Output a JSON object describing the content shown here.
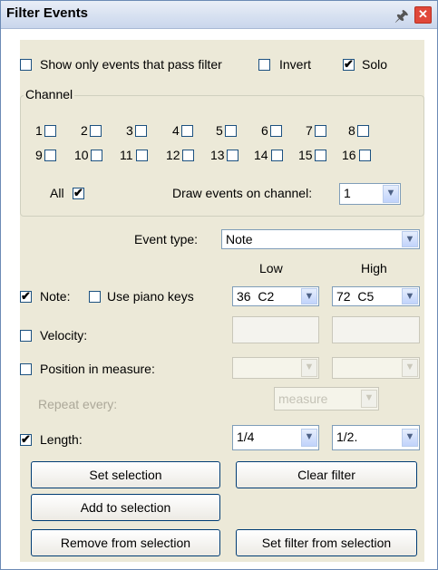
{
  "window": {
    "title": "Filter Events"
  },
  "top": {
    "show_only": {
      "label": "Show only events that pass filter",
      "checked": false
    },
    "invert": {
      "label": "Invert",
      "checked": false
    },
    "solo": {
      "label": "Solo",
      "checked": true
    }
  },
  "channel": {
    "title": "Channel",
    "row1": [
      "1",
      "2",
      "3",
      "4",
      "5",
      "6",
      "7",
      "8"
    ],
    "row2": [
      "9",
      "10",
      "11",
      "12",
      "13",
      "14",
      "15",
      "16"
    ],
    "all_label": "All",
    "all_checked": true,
    "draw_label": "Draw events on channel:",
    "draw_value": "1"
  },
  "event_type": {
    "label": "Event type:",
    "value": "Note"
  },
  "headers": {
    "low": "Low",
    "high": "High"
  },
  "note": {
    "label": "Note:",
    "checked": true,
    "piano_label": "Use piano keys",
    "piano_checked": false,
    "low": "36  C2",
    "high": "72  C5"
  },
  "velocity": {
    "label": "Velocity:",
    "checked": false
  },
  "position": {
    "label": "Position in measure:",
    "checked": false
  },
  "repeat": {
    "label": "Repeat every:",
    "value": "measure"
  },
  "length": {
    "label": "Length:",
    "checked": true,
    "low": "1/4",
    "high": "1/2."
  },
  "buttons": {
    "set_selection": "Set selection",
    "clear_filter": "Clear filter",
    "add_to_selection": "Add to selection",
    "remove_from_selection": "Remove from selection",
    "set_filter_from_selection": "Set filter from selection"
  }
}
